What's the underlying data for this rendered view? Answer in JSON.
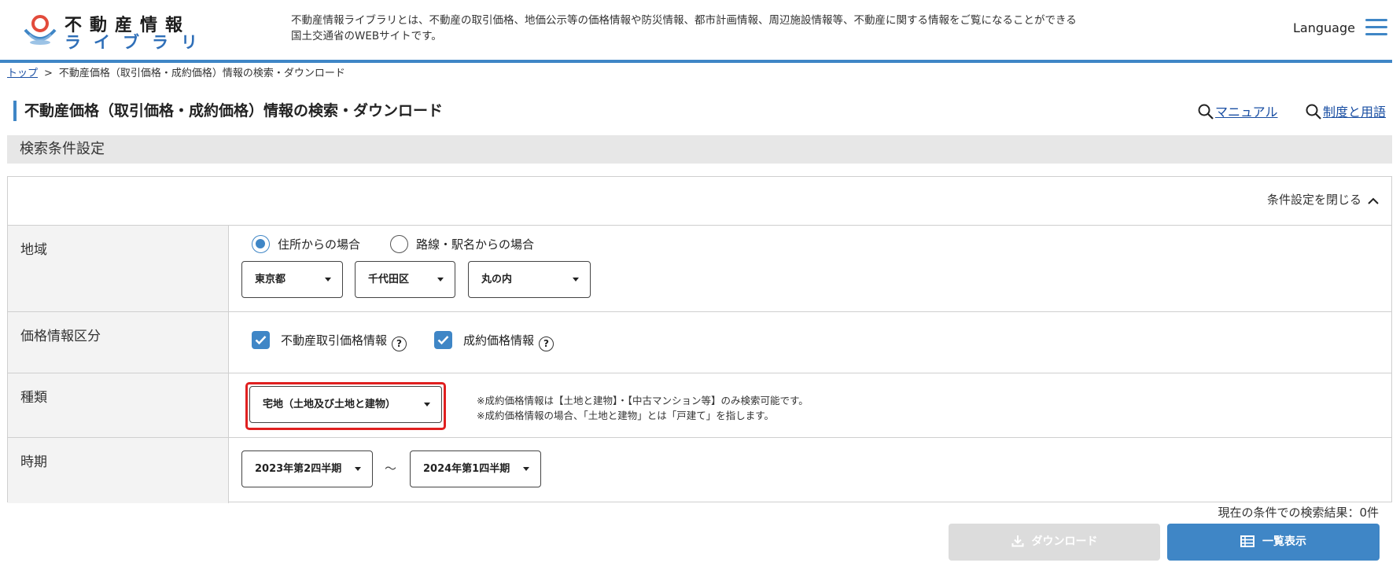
{
  "header": {
    "logo_line1": "不動産情報",
    "logo_line2": "ライブラリ",
    "description_line1": "不動産情報ライブラリとは、不動産の取引価格、地価公示等の価格情報や防災情報、都市計画情報、周辺施設情報等、不動産に関する情報をご覧になることができる",
    "description_line2": "国土交通省のWEBサイトです。",
    "language_label": "Language"
  },
  "breadcrumb": {
    "top_label": "トップ",
    "separator": ">",
    "current": "不動産価格（取引価格・成約価格）情報の検索・ダウンロード"
  },
  "page": {
    "title": "不動産価格（取引価格・成約価格）情報の検索・ダウンロード",
    "manual_link": "マニュアル",
    "terms_link": "制度と用語"
  },
  "section": {
    "title": "検索条件設定",
    "close_label": "条件設定を閉じる"
  },
  "form": {
    "region": {
      "label": "地域",
      "radio_address": "住所からの場合",
      "radio_station": "路線・駅名からの場合",
      "selected_radio": "住所からの場合",
      "prefecture": "東京都",
      "city": "千代田区",
      "district": "丸の内"
    },
    "price_type": {
      "label": "価格情報区分",
      "option1": "不動産取引価格情報",
      "option2": "成約価格情報",
      "option1_checked": true,
      "option2_checked": true,
      "help_symbol": "?"
    },
    "kind": {
      "label": "種類",
      "selected": "宅地（土地及び土地と建物）",
      "note1": "※成約価格情報は【土地と建物】・【中古マンション等】のみ検索可能です。",
      "note2": "※成約価格情報の場合、「土地と建物」とは「戸建て」を指します。"
    },
    "period": {
      "label": "時期",
      "from": "2023年第2四半期",
      "separator": "～",
      "to": "2024年第1四半期"
    }
  },
  "results": {
    "count_text": "現在の条件での検索結果：0件",
    "download_label": "ダウンロード",
    "list_label": "一覧表示"
  },
  "colors": {
    "accent": "#3f86c6",
    "highlight": "#e02020",
    "disabled": "#dcdcdc"
  }
}
